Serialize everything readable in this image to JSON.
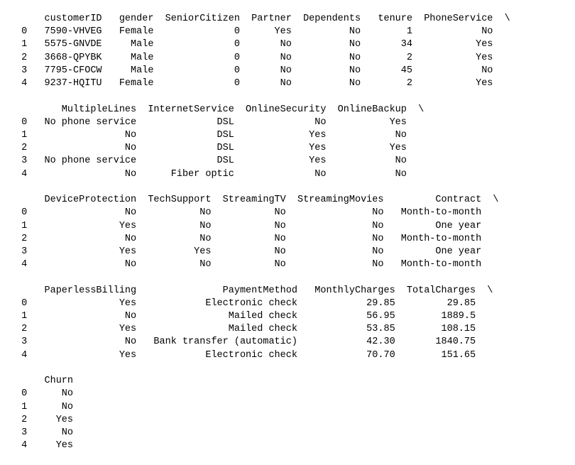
{
  "dataframe": {
    "index": [
      0,
      1,
      2,
      3,
      4
    ],
    "columns": [
      "customerID",
      "gender",
      "SeniorCitizen",
      "Partner",
      "Dependents",
      "tenure",
      "PhoneService",
      "MultipleLines",
      "InternetService",
      "OnlineSecurity",
      "OnlineBackup",
      "DeviceProtection",
      "TechSupport",
      "StreamingTV",
      "StreamingMovies",
      "Contract",
      "PaperlessBilling",
      "PaymentMethod",
      "MonthlyCharges",
      "TotalCharges",
      "Churn"
    ],
    "rows": [
      {
        "customerID": "7590-VHVEG",
        "gender": "Female",
        "SeniorCitizen": "0",
        "Partner": "Yes",
        "Dependents": "No",
        "tenure": "1",
        "PhoneService": "No",
        "MultipleLines": "No phone service",
        "InternetService": "DSL",
        "OnlineSecurity": "No",
        "OnlineBackup": "Yes",
        "DeviceProtection": "No",
        "TechSupport": "No",
        "StreamingTV": "No",
        "StreamingMovies": "No",
        "Contract": "Month-to-month",
        "PaperlessBilling": "Yes",
        "PaymentMethod": "Electronic check",
        "MonthlyCharges": "29.85",
        "TotalCharges": "29.85",
        "Churn": "No"
      },
      {
        "customerID": "5575-GNVDE",
        "gender": "Male",
        "SeniorCitizen": "0",
        "Partner": "No",
        "Dependents": "No",
        "tenure": "34",
        "PhoneService": "Yes",
        "MultipleLines": "No",
        "InternetService": "DSL",
        "OnlineSecurity": "Yes",
        "OnlineBackup": "No",
        "DeviceProtection": "Yes",
        "TechSupport": "No",
        "StreamingTV": "No",
        "StreamingMovies": "No",
        "Contract": "One year",
        "PaperlessBilling": "No",
        "PaymentMethod": "Mailed check",
        "MonthlyCharges": "56.95",
        "TotalCharges": "1889.5",
        "Churn": "No"
      },
      {
        "customerID": "3668-QPYBK",
        "gender": "Male",
        "SeniorCitizen": "0",
        "Partner": "No",
        "Dependents": "No",
        "tenure": "2",
        "PhoneService": "Yes",
        "MultipleLines": "No",
        "InternetService": "DSL",
        "OnlineSecurity": "Yes",
        "OnlineBackup": "Yes",
        "DeviceProtection": "No",
        "TechSupport": "No",
        "StreamingTV": "No",
        "StreamingMovies": "No",
        "Contract": "Month-to-month",
        "PaperlessBilling": "Yes",
        "PaymentMethod": "Mailed check",
        "MonthlyCharges": "53.85",
        "TotalCharges": "108.15",
        "Churn": "Yes"
      },
      {
        "customerID": "7795-CFOCW",
        "gender": "Male",
        "SeniorCitizen": "0",
        "Partner": "No",
        "Dependents": "No",
        "tenure": "45",
        "PhoneService": "No",
        "MultipleLines": "No phone service",
        "InternetService": "DSL",
        "OnlineSecurity": "Yes",
        "OnlineBackup": "No",
        "DeviceProtection": "Yes",
        "TechSupport": "Yes",
        "StreamingTV": "No",
        "StreamingMovies": "No",
        "Contract": "One year",
        "PaperlessBilling": "No",
        "PaymentMethod": "Bank transfer (automatic)",
        "MonthlyCharges": "42.30",
        "TotalCharges": "1840.75",
        "Churn": "No"
      },
      {
        "customerID": "9237-HQITU",
        "gender": "Female",
        "SeniorCitizen": "0",
        "Partner": "No",
        "Dependents": "No",
        "tenure": "2",
        "PhoneService": "Yes",
        "MultipleLines": "No",
        "InternetService": "Fiber optic",
        "OnlineSecurity": "No",
        "OnlineBackup": "No",
        "DeviceProtection": "No",
        "TechSupport": "No",
        "StreamingTV": "No",
        "StreamingMovies": "No",
        "Contract": "Month-to-month",
        "PaperlessBilling": "Yes",
        "PaymentMethod": "Electronic check",
        "MonthlyCharges": "70.70",
        "TotalCharges": "151.65",
        "Churn": "Yes"
      }
    ],
    "continuation_glyph": "\\",
    "blocks": [
      {
        "cols": [
          "customerID",
          "gender",
          "SeniorCitizen",
          "Partner",
          "Dependents",
          "tenure",
          "PhoneService"
        ],
        "wrap": true,
        "idx_w": 2,
        "widths": [
          12,
          8,
          14,
          8,
          11,
          8,
          13
        ]
      },
      {
        "cols": [
          "MultipleLines",
          "InternetService",
          "OnlineSecurity",
          "OnlineBackup"
        ],
        "wrap": true,
        "idx_w": 2,
        "widths": [
          18,
          16,
          15,
          13
        ]
      },
      {
        "cols": [
          "DeviceProtection",
          "TechSupport",
          "StreamingTV",
          "StreamingMovies",
          "Contract"
        ],
        "wrap": true,
        "idx_w": 2,
        "widths": [
          18,
          12,
          12,
          16,
          16
        ]
      },
      {
        "cols": [
          "PaperlessBilling",
          "PaymentMethod",
          "MonthlyCharges",
          "TotalCharges"
        ],
        "wrap": true,
        "idx_w": 2,
        "widths": [
          18,
          27,
          16,
          13
        ]
      },
      {
        "cols": [
          "Churn"
        ],
        "wrap": false,
        "idx_w": 2,
        "widths": [
          7
        ]
      }
    ]
  }
}
